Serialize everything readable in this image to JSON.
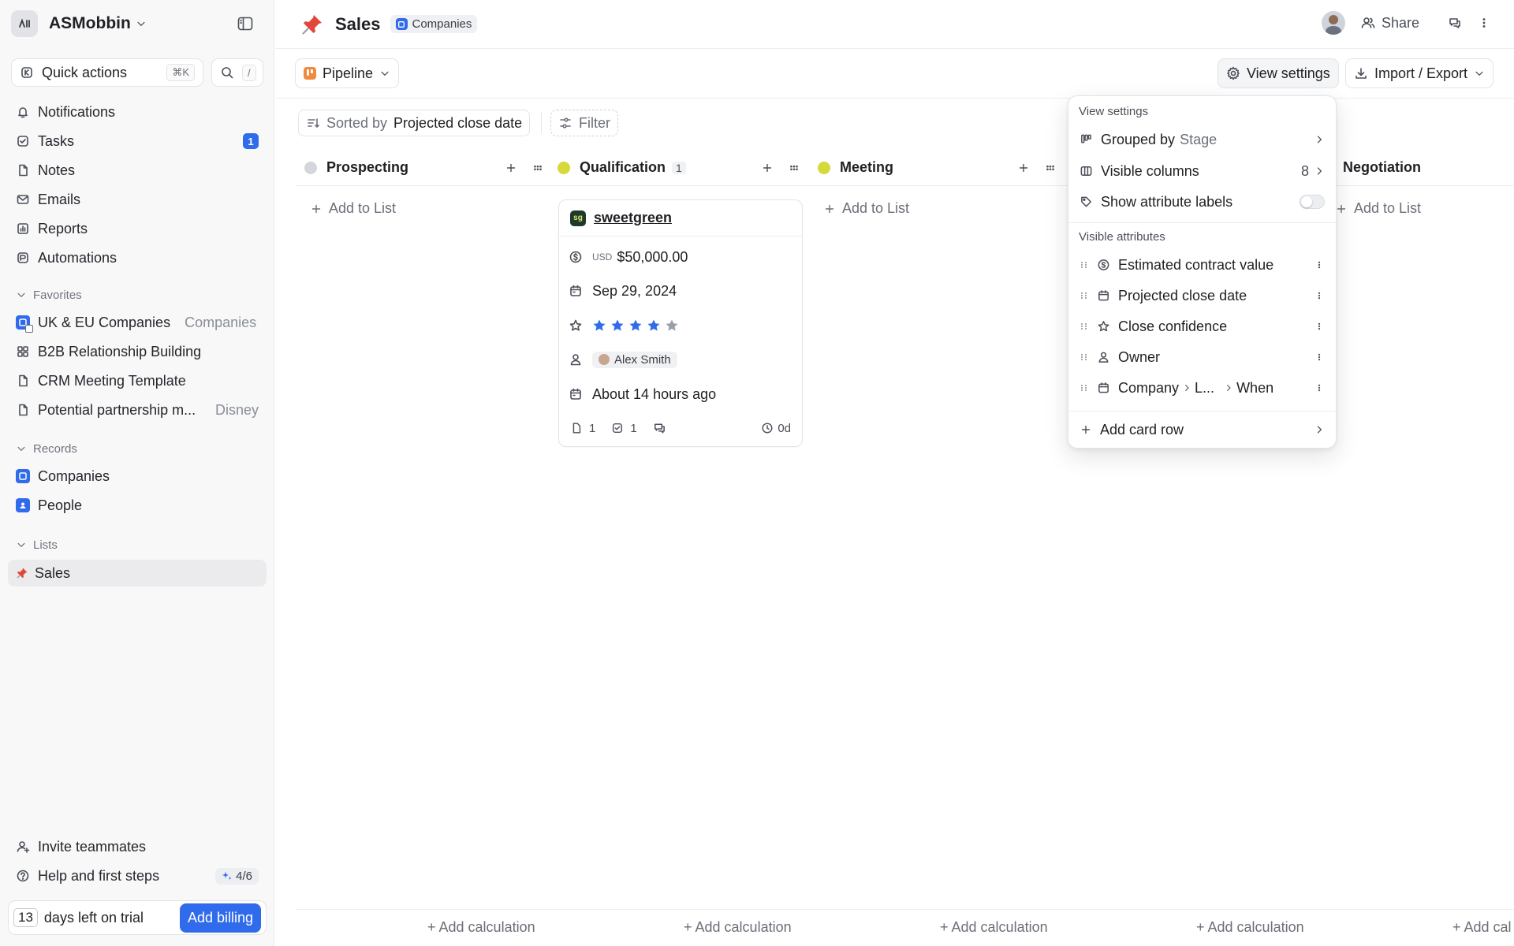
{
  "workspace": {
    "name": "ASMobbin",
    "logo_text": "A"
  },
  "sidebar": {
    "quick_actions": {
      "label": "Quick actions",
      "shortcut": "⌘K"
    },
    "search_shortcut": "/",
    "main": [
      {
        "label": "Notifications",
        "icon": "bell-icon"
      },
      {
        "label": "Tasks",
        "icon": "check-square-icon",
        "badge": "1"
      },
      {
        "label": "Notes",
        "icon": "document-icon"
      },
      {
        "label": "Emails",
        "icon": "mail-icon"
      },
      {
        "label": "Reports",
        "icon": "chart-icon"
      },
      {
        "label": "Automations",
        "icon": "automation-icon"
      }
    ],
    "favorites_header": "Favorites",
    "favorites": [
      {
        "label": "UK & EU Companies",
        "sub": "Companies",
        "icon": "companies-list-icon"
      },
      {
        "label": "B2B Relationship Building",
        "sub": "",
        "icon": "grid-icon"
      },
      {
        "label": "CRM Meeting Template",
        "sub": "",
        "icon": "document-icon"
      },
      {
        "label": "Potential partnership m...",
        "sub": "Disney",
        "icon": "document-icon"
      }
    ],
    "records_header": "Records",
    "records": [
      {
        "label": "Companies",
        "icon": "company-icon"
      },
      {
        "label": "People",
        "icon": "person-icon"
      }
    ],
    "lists_header": "Lists",
    "lists": [
      {
        "label": "Sales",
        "icon": "pushpin-icon"
      }
    ],
    "footer": {
      "invite": "Invite teammates",
      "help": "Help and first steps",
      "progress": "4/6",
      "trial_days": "13",
      "trial_text": "days left on trial",
      "billing_button": "Add billing"
    }
  },
  "header": {
    "title": "Sales",
    "object_chip": "Companies",
    "share": "Share"
  },
  "toolbar": {
    "view_name": "Pipeline",
    "view_settings": "View settings",
    "import_export": "Import / Export"
  },
  "filters": {
    "sorted_by_label": "Sorted by",
    "sorted_by_value": "Projected close date",
    "filter": "Filter"
  },
  "board": {
    "add_to_list": "Add to List",
    "add_calculation": "+ Add calculation",
    "add_calculation_cut": "+ Add cal",
    "columns": [
      {
        "name": "Prospecting",
        "color": "#d4d6db",
        "count": ""
      },
      {
        "name": "Qualification",
        "color": "#d5d93a",
        "count": "1"
      },
      {
        "name": "Meeting",
        "color": "#d5d93a",
        "count": ""
      },
      {
        "name": "Negotiation",
        "color": "#6b8ef5",
        "count": ""
      }
    ],
    "card": {
      "company": "sweetgreen",
      "logo_text": "sg",
      "currency": "USD",
      "value": "$50,000.00",
      "close_date": "Sep 29, 2024",
      "confidence_stars": 4,
      "confidence_max": 5,
      "owner": "Alex Smith",
      "last_interaction": "About 14 hours ago",
      "notes_count": "1",
      "tasks_count": "1",
      "age": "0d"
    }
  },
  "view_settings": {
    "header": "View settings",
    "grouped_by_label": "Grouped by",
    "grouped_by_value": "Stage",
    "visible_columns_label": "Visible columns",
    "visible_columns_count": "8",
    "show_labels": "Show attribute labels",
    "attributes_header": "Visible attributes",
    "attributes": [
      {
        "label": "Estimated contract value",
        "icon": "currency-icon"
      },
      {
        "label": "Projected close date",
        "icon": "calendar-icon"
      },
      {
        "label": "Close confidence",
        "icon": "star-icon"
      },
      {
        "label": "Owner",
        "icon": "person-outline-icon"
      }
    ],
    "path_attribute": {
      "part1": "Company",
      "part2": "L...",
      "part3": "When"
    },
    "add_card_row": "Add card row"
  },
  "colors": {
    "accent": "#2f6bea",
    "star_active": "#2f6bea",
    "star_inactive": "#9aa0aa"
  }
}
